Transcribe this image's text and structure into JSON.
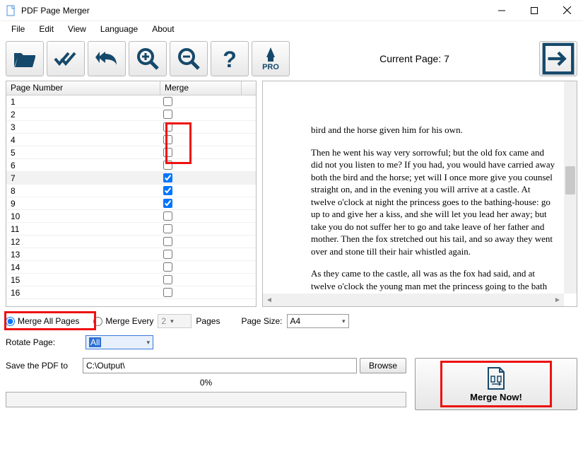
{
  "window": {
    "title": "PDF Page Merger"
  },
  "menus": [
    "File",
    "Edit",
    "View",
    "Language",
    "About"
  ],
  "toolbar": {
    "pro_label": "PRO"
  },
  "current_page_label": "Current Page: 7",
  "table": {
    "headers": {
      "page_number": "Page Number",
      "merge": "Merge"
    },
    "rows": [
      {
        "num": "1",
        "checked": false
      },
      {
        "num": "2",
        "checked": false
      },
      {
        "num": "3",
        "checked": false
      },
      {
        "num": "4",
        "checked": false
      },
      {
        "num": "5",
        "checked": false
      },
      {
        "num": "6",
        "checked": false
      },
      {
        "num": "7",
        "checked": true,
        "selected": true
      },
      {
        "num": "8",
        "checked": true
      },
      {
        "num": "9",
        "checked": true
      },
      {
        "num": "10",
        "checked": false
      },
      {
        "num": "11",
        "checked": false
      },
      {
        "num": "12",
        "checked": false
      },
      {
        "num": "13",
        "checked": false
      },
      {
        "num": "14",
        "checked": false
      },
      {
        "num": "15",
        "checked": false
      },
      {
        "num": "16",
        "checked": false
      }
    ]
  },
  "preview": {
    "p1": "bird and the horse given him for his own.",
    "p2": "Then he went his way very sorrowful; but the old fox came and did not you listen to me? If you had, you would have carried away both the bird and the horse; yet will I once more give you counsel straight on, and in the evening you will arrive at a castle. At twelve o'clock at night the princess goes to the bathing-house: go up to and give her a kiss, and she will let you lead her away; but take you do not suffer her to go and take leave of her father and mother. Then the fox stretched out his tail, and so away they went over and stone till their hair whistled again.",
    "p3": "As they came to the castle, all was as the fox had said, and at twelve o'clock the young man met the princess going to the bath and gave"
  },
  "options": {
    "merge_all_label": "Merge All Pages",
    "merge_every_label": "Merge Every",
    "merge_every_value": "2",
    "pages_label": "Pages",
    "page_size_label": "Page Size:",
    "page_size_value": "A4",
    "rotate_label": "Rotate Page:",
    "rotate_value": "All"
  },
  "save": {
    "label": "Save the PDF to",
    "path": "C:\\Output\\",
    "browse_label": "Browse"
  },
  "progress": {
    "label": "0%"
  },
  "merge_now_label": "Merge Now!"
}
